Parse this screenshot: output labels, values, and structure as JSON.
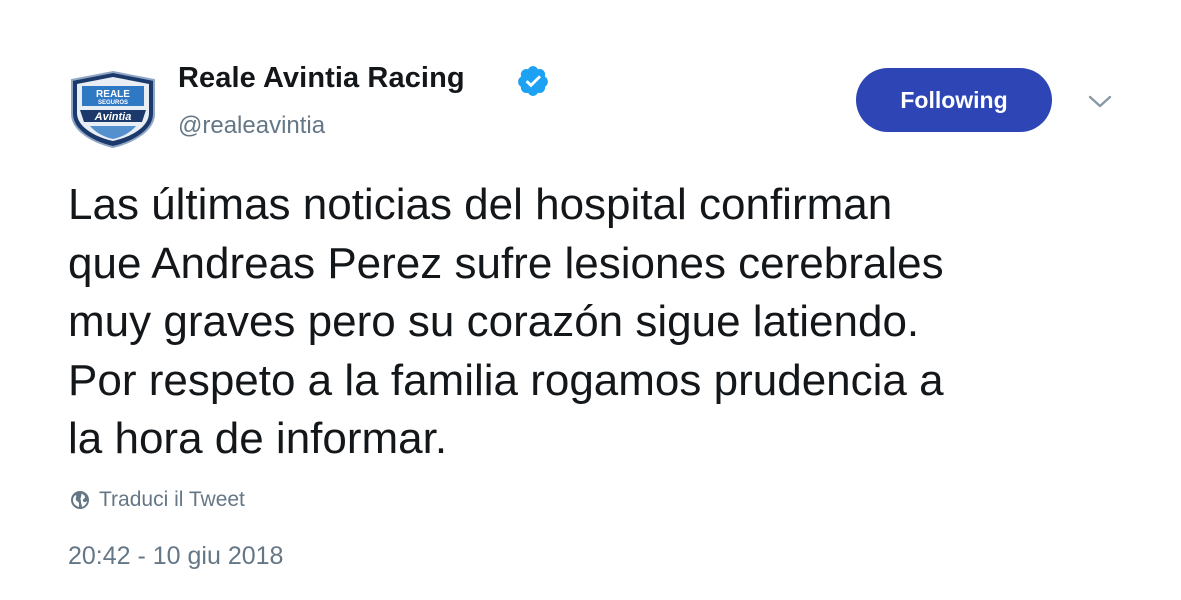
{
  "tweet": {
    "author": {
      "display_name": "Reale Avintia Racing",
      "handle": "@realeavintia",
      "verified": true,
      "avatar_logo": {
        "line1": "REALE",
        "line2": "SEGUROS",
        "line3": "Avintia"
      }
    },
    "follow_button_label": "Following",
    "text": "Las últimas noticias del hospital confirman\nque Andreas Perez sufre lesiones cerebrales\nmuy graves pero su corazón sigue latiendo.\nPor respeto a la familia rogamos prudencia a\nla hora de informar.",
    "translate_label": "Traduci il Tweet",
    "timestamp": "20:42 - 10 giu 2018"
  },
  "colors": {
    "button_bg": "#2d45b5",
    "verified": "#1da1f2",
    "secondary_text": "#657786",
    "primary_text": "#14171a",
    "logo_navy": "#1b3a6b",
    "logo_blue": "#2f78c4"
  },
  "icons": {
    "verified": "verified-badge-icon",
    "caret": "chevron-down-icon",
    "globe": "globe-icon"
  }
}
